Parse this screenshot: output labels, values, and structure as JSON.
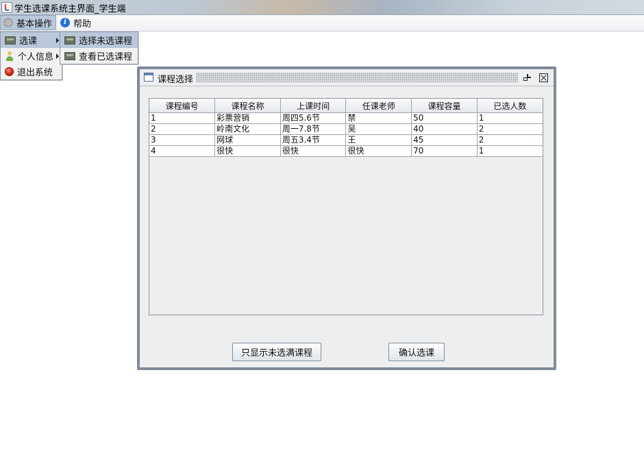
{
  "window": {
    "title": "学生选课系统主界面_学生端"
  },
  "menubar": {
    "basic": "基本操作",
    "help": "帮助"
  },
  "basic_menu": {
    "items": [
      {
        "label": "选课",
        "icon": "screen-icon"
      },
      {
        "label": "个人信息",
        "icon": "person-icon"
      },
      {
        "label": "退出系统",
        "icon": "exit-icon"
      }
    ]
  },
  "course_submenu": {
    "items": [
      {
        "label": "选择未选课程",
        "icon": "screen-icon"
      },
      {
        "label": "查看已选课程",
        "icon": "screen-icon"
      }
    ]
  },
  "frame": {
    "title": "课程选择",
    "table": {
      "columns": [
        "课程编号",
        "课程名称",
        "上课时间",
        "任课老师",
        "课程容量",
        "已选人数"
      ],
      "rows": [
        [
          "1",
          "彩票营销",
          "周四5.6节",
          "禁",
          "50",
          "1"
        ],
        [
          "2",
          "岭南文化",
          "周一7.8节",
          "吴",
          "40",
          "2"
        ],
        [
          "3",
          "网球",
          "周五3.4节",
          "王",
          "45",
          "2"
        ],
        [
          "4",
          "很快",
          "很快",
          "很快",
          "70",
          "1"
        ]
      ]
    },
    "buttons": {
      "show_unfull": "只显示未选满课程",
      "confirm": "确认选课"
    }
  }
}
